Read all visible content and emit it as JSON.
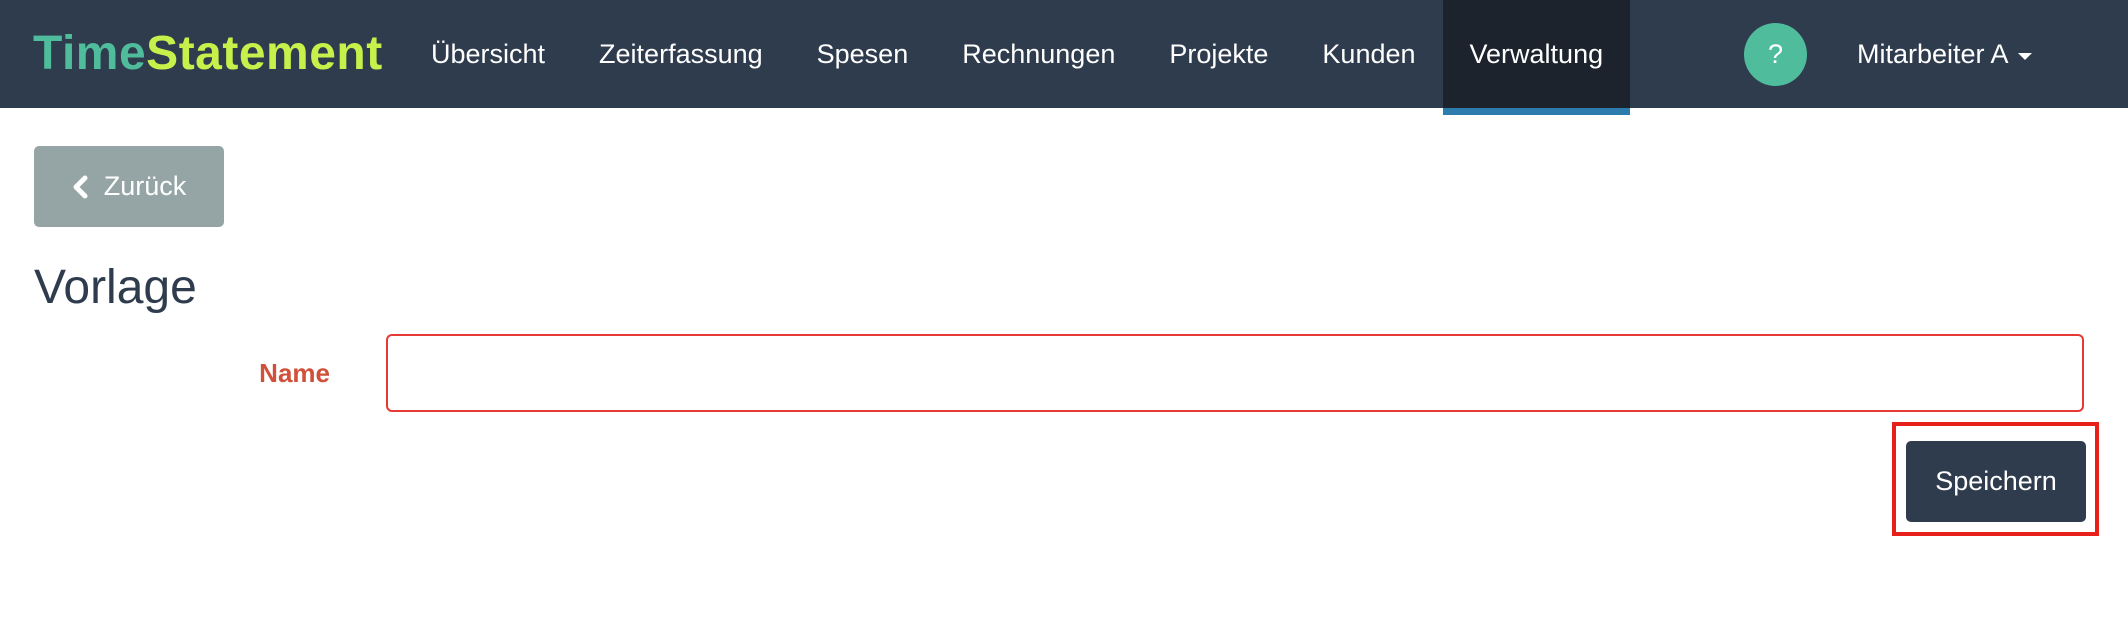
{
  "brand": {
    "part1": "Time",
    "part2": "Statement",
    "colors": {
      "part1": "#4fbd9b",
      "part2": "#c8f04a"
    }
  },
  "nav": {
    "items": [
      {
        "label": "Übersicht",
        "active": false
      },
      {
        "label": "Zeiterfassung",
        "active": false
      },
      {
        "label": "Spesen",
        "active": false
      },
      {
        "label": "Rechnungen",
        "active": false
      },
      {
        "label": "Projekte",
        "active": false
      },
      {
        "label": "Kunden",
        "active": false
      },
      {
        "label": "Verwaltung",
        "active": true
      }
    ],
    "help_label": "?",
    "user_label": "Mitarbeiter A"
  },
  "toolbar": {
    "back_label": "Zurück",
    "back_icon": "chevron-left-icon"
  },
  "page": {
    "title": "Vorlage"
  },
  "form": {
    "name_label": "Name",
    "name_value": "",
    "name_placeholder": "",
    "save_label": "Speichern"
  },
  "colors": {
    "navbar": "#2f3c4e",
    "accent": "#4fbd9b",
    "error": "#e53935",
    "highlight": "#e8201c"
  }
}
